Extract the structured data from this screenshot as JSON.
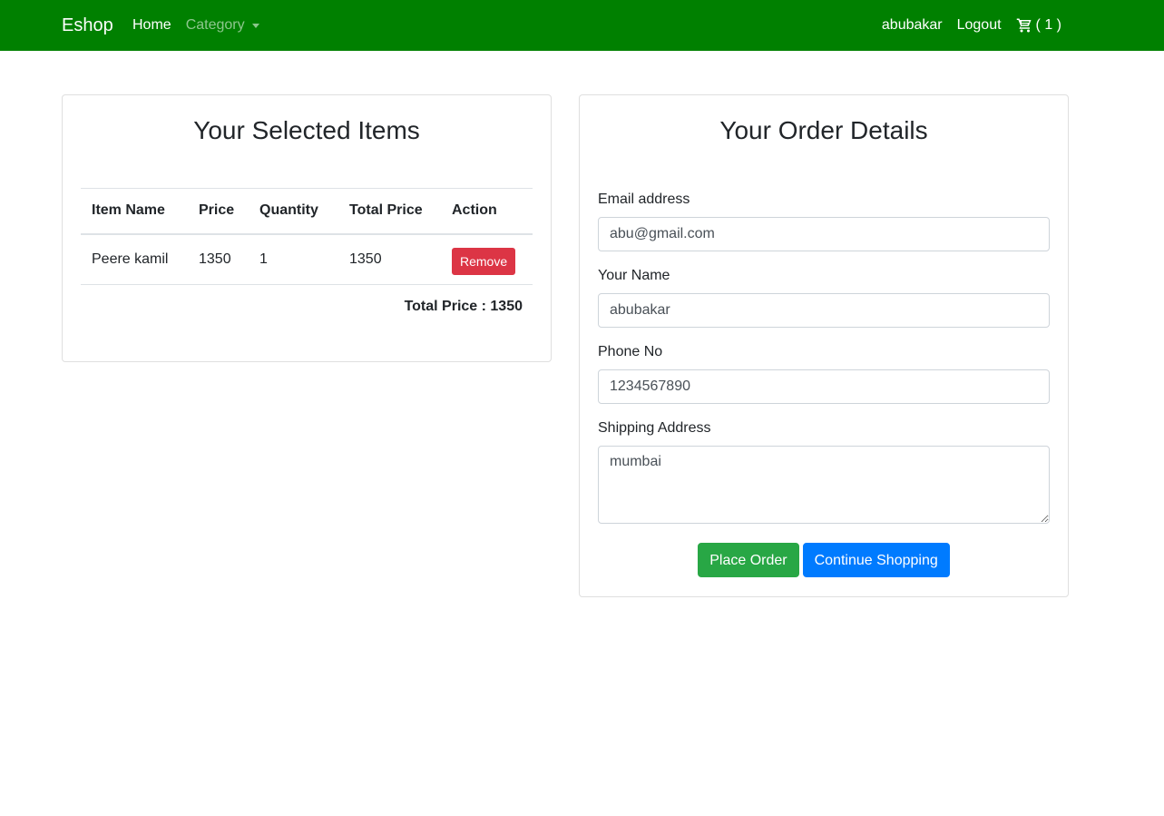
{
  "navbar": {
    "brand": "Eshop",
    "home": "Home",
    "category": "Category",
    "user": "abubakar",
    "logout": "Logout",
    "cart_count": "( 1 )",
    "bg_color": "#008000"
  },
  "cart_panel": {
    "title": "Your Selected Items",
    "columns": [
      "Item Name",
      "Price",
      "Quantity",
      "Total Price",
      "Action"
    ],
    "rows": [
      {
        "item": "Peere kamil",
        "price": "1350",
        "quantity": "1",
        "total": "1350",
        "action": "Remove"
      }
    ],
    "total_text": "Total Price : 1350"
  },
  "order_panel": {
    "title": "Your Order Details",
    "email_label": "Email address",
    "email_value": "abu@gmail.com",
    "name_label": "Your Name",
    "name_value": "abubakar",
    "phone_label": "Phone No",
    "phone_value": "1234567890",
    "address_label": "Shipping Address",
    "address_value": "mumbai",
    "place_order": "Place Order",
    "continue_shopping": "Continue Shopping"
  }
}
